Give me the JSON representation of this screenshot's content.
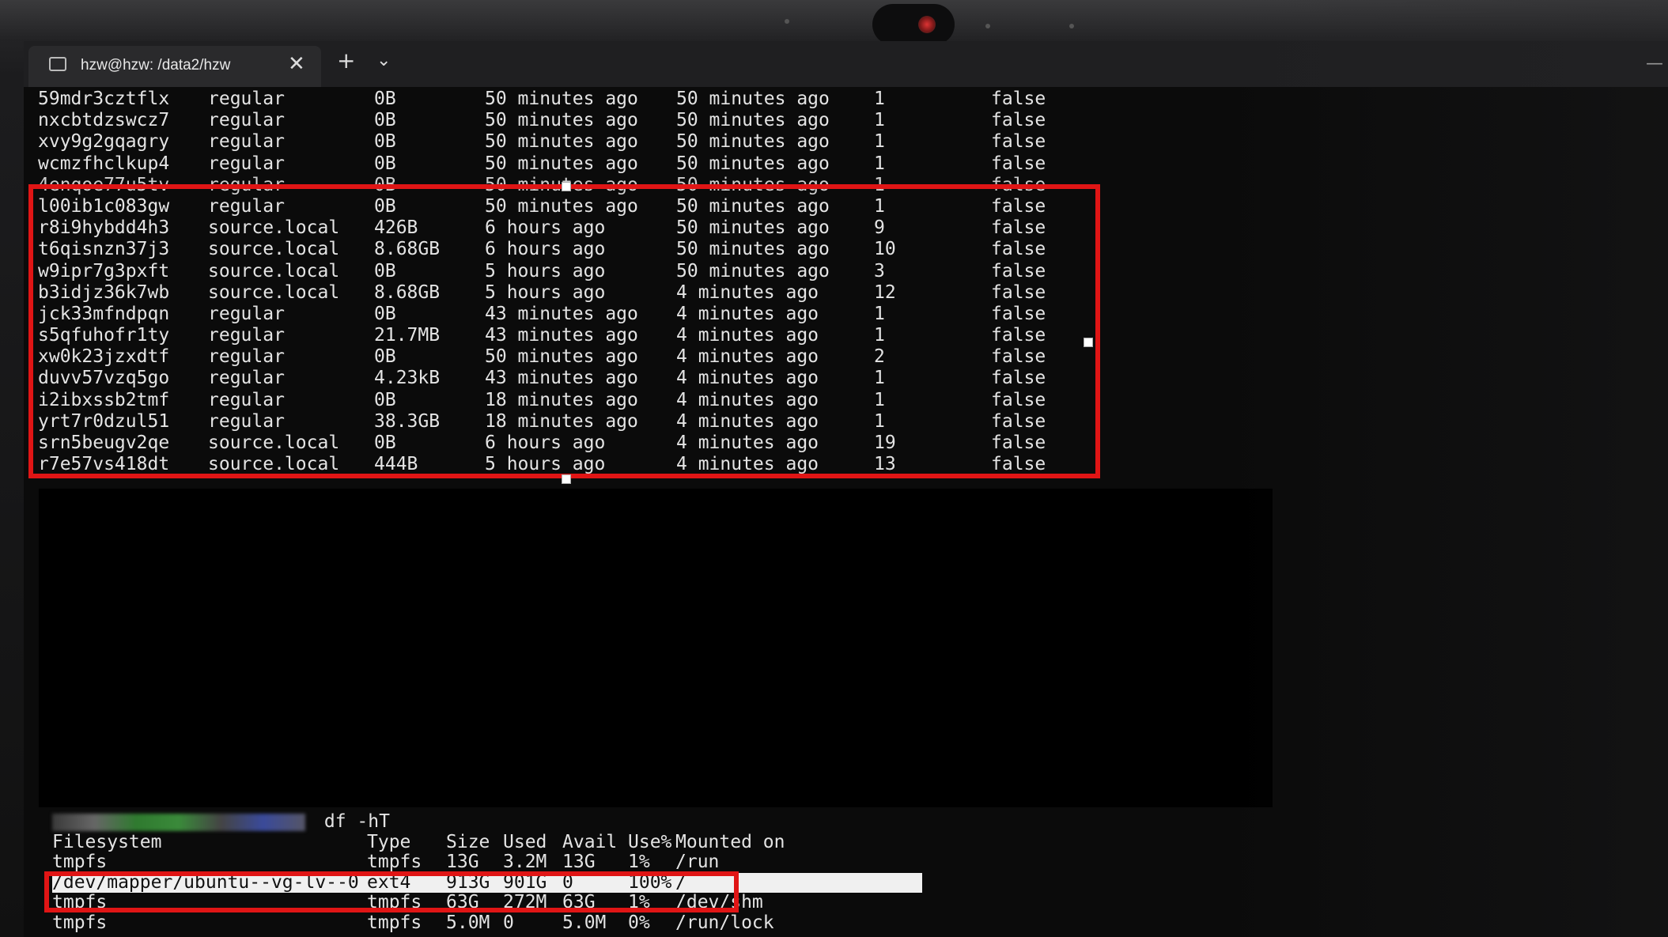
{
  "window": {
    "tab_title": "hzw@hzw: /data2/hzw",
    "tab_close": "✕",
    "new_tab": "+",
    "tab_dropdown": "⌄",
    "minimize": "—"
  },
  "volumes": [
    [
      "59mdr3cztflx",
      "regular",
      "0B",
      "50 minutes ago",
      "50 minutes ago",
      "1",
      "false"
    ],
    [
      "nxcbtdzswcz7",
      "regular",
      "0B",
      "50 minutes ago",
      "50 minutes ago",
      "1",
      "false"
    ],
    [
      "xvy9g2gqagry",
      "regular",
      "0B",
      "50 minutes ago",
      "50 minutes ago",
      "1",
      "false"
    ],
    [
      "wcmzfhclkup4",
      "regular",
      "0B",
      "50 minutes ago",
      "50 minutes ago",
      "1",
      "false"
    ],
    [
      "4enqoe77u5tv",
      "regular",
      "0B",
      "50 minutes ago",
      "50 minutes ago",
      "1",
      "false"
    ],
    [
      "l00ib1c083gw",
      "regular",
      "0B",
      "50 minutes ago",
      "50 minutes ago",
      "1",
      "false"
    ],
    [
      "r8i9hybdd4h3",
      "source.local",
      "426B",
      "6 hours ago",
      "50 minutes ago",
      "9",
      "false"
    ],
    [
      "t6qisnzn37j3",
      "source.local",
      "8.68GB",
      "6 hours ago",
      "50 minutes ago",
      "10",
      "false"
    ],
    [
      "w9ipr7g3pxft",
      "source.local",
      "0B",
      "5 hours ago",
      "50 minutes ago",
      "3",
      "false"
    ],
    [
      "b3idjz36k7wb",
      "source.local",
      "8.68GB",
      "5 hours ago",
      "4 minutes ago",
      "12",
      "false"
    ],
    [
      "jck33mfndpqn",
      "regular",
      "0B",
      "43 minutes ago",
      "4 minutes ago",
      "1",
      "false"
    ],
    [
      "s5qfuhofr1ty",
      "regular",
      "21.7MB",
      "43 minutes ago",
      "4 minutes ago",
      "1",
      "false"
    ],
    [
      "xw0k23jzxdtf",
      "regular",
      "0B",
      "50 minutes ago",
      "4 minutes ago",
      "2",
      "false"
    ],
    [
      "duvv57vzq5go",
      "regular",
      "4.23kB",
      "43 minutes ago",
      "4 minutes ago",
      "1",
      "false"
    ],
    [
      "i2ibxssb2tmf",
      "regular",
      "0B",
      "18 minutes ago",
      "4 minutes ago",
      "1",
      "false"
    ],
    [
      "yrt7r0dzul51",
      "regular",
      "38.3GB",
      "18 minutes ago",
      "4 minutes ago",
      "1",
      "false"
    ],
    [
      "srn5beugv2qe",
      "source.local",
      "0B",
      "6 hours ago",
      "4 minutes ago",
      "19",
      "false"
    ],
    [
      "r7e57vs418dt",
      "source.local",
      "444B",
      "5 hours ago",
      "4 minutes ago",
      "13",
      "false"
    ]
  ],
  "df": {
    "command": "df -hT",
    "header": [
      "Filesystem",
      "Type",
      "Size",
      "Used",
      "Avail",
      "Use%",
      "Mounted on"
    ],
    "rows": [
      [
        "tmpfs",
        "tmpfs",
        "13G",
        "3.2M",
        "13G",
        "1%",
        "/run"
      ],
      [
        "/dev/mapper/ubuntu--vg-lv--0",
        "ext4",
        "913G",
        "901G",
        "0",
        "100%",
        "/"
      ],
      [
        "tmpfs",
        "tmpfs",
        "63G",
        "272M",
        "63G",
        "1%",
        "/dev/shm"
      ],
      [
        "tmpfs",
        "tmpfs",
        "5.0M",
        "0",
        "5.0M",
        "0%",
        "/run/lock"
      ]
    ]
  },
  "colors": {
    "highlight": "#e01515",
    "terminal_bg": "#0b0b0b",
    "text": "#e4e4e4"
  },
  "icons": [
    "terminal-icon",
    "close-icon",
    "plus-icon",
    "chevron-down-icon",
    "minimize-icon",
    "camera-icon"
  ]
}
